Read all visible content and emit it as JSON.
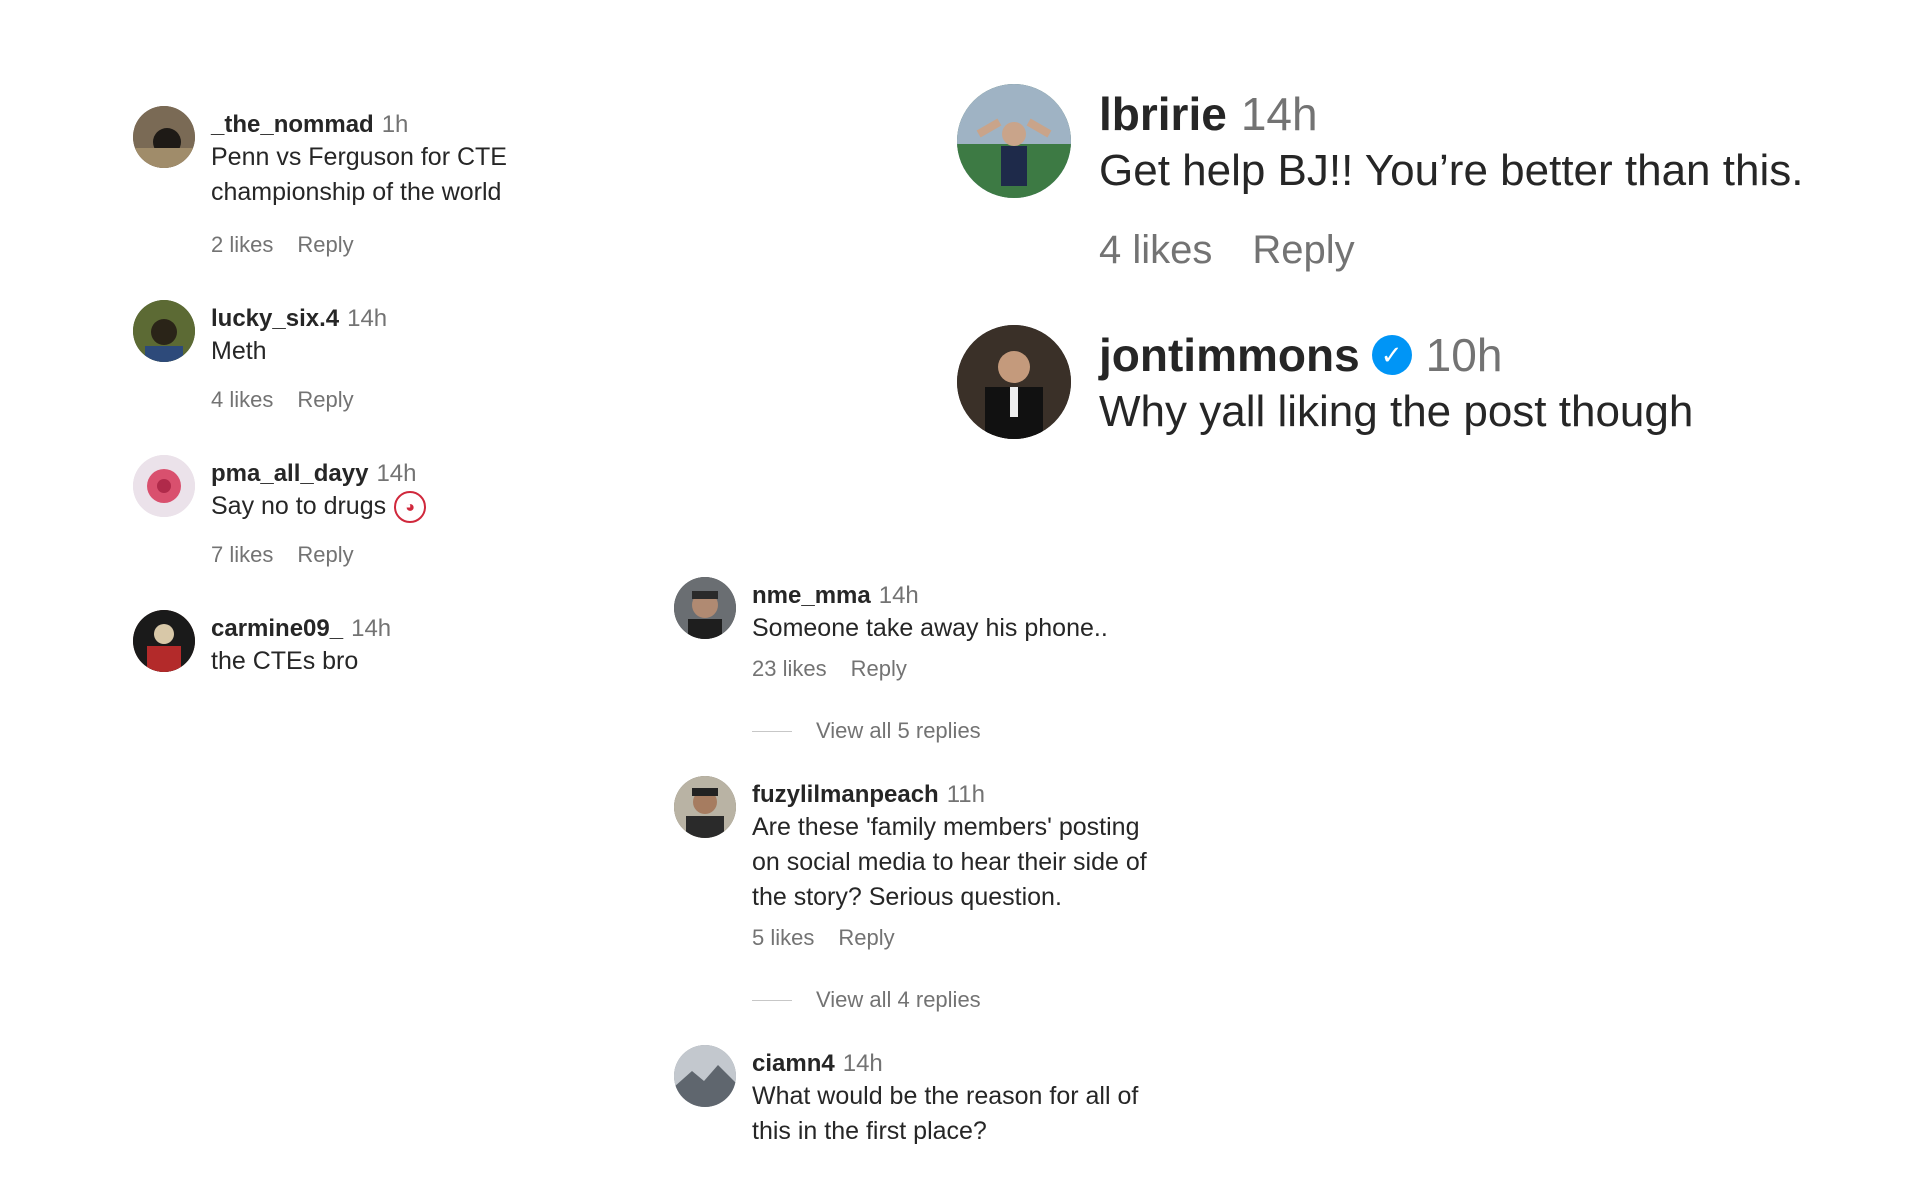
{
  "left_comments": [
    {
      "username": "_the_nommad",
      "time": "1h",
      "text_lines": [
        "Penn vs Ferguson for CTE",
        "championship of the world"
      ],
      "likes": "2 likes",
      "reply": "Reply",
      "avatar_color": "#6b5a44"
    },
    {
      "username": "lucky_six.4",
      "time": "14h",
      "text_lines": [
        "Meth"
      ],
      "likes": "4 likes",
      "reply": "Reply",
      "avatar_color": "#4a5a2e"
    },
    {
      "username": "pma_all_dayy",
      "time": "14h",
      "text_lines": [
        "Say no to drugs"
      ],
      "emoji": "clown-face",
      "likes": "7 likes",
      "reply": "Reply",
      "avatar_color": "#d9506e"
    },
    {
      "username": "carmine09_",
      "time": "14h",
      "text_lines": [
        "the CTEs bro"
      ],
      "avatar_color": "#5a2a22"
    }
  ],
  "right_comments": [
    {
      "username": "lbririe",
      "time": "14h",
      "text": "Get help BJ!! You’re better than this.",
      "likes": "4 likes",
      "reply": "Reply",
      "avatar_color": "#3b6b4a"
    },
    {
      "username": "jontimmons",
      "verified": true,
      "time": "10h",
      "text": "Why yall liking the post though",
      "avatar_color": "#2d2a26"
    }
  ],
  "middle_comments": [
    {
      "username": "nme_mma",
      "time": "14h",
      "text_lines": [
        "Someone take away his phone.."
      ],
      "likes": "23 likes",
      "reply": "Reply",
      "view_replies": "View all 5 replies",
      "avatar_color": "#3f3f3f"
    },
    {
      "username": "fuzylilmanpeach",
      "time": "11h",
      "text_lines": [
        "Are these 'family members' posting",
        "on social media to hear their side of",
        "the story? Serious question."
      ],
      "likes": "5 likes",
      "reply": "Reply",
      "view_replies": "View all 4 replies",
      "avatar_color": "#6b6250"
    },
    {
      "username": "ciamn4",
      "time": "14h",
      "text_lines": [
        "What would be the reason for all of",
        "this in the first place?"
      ],
      "avatar_color": "#8a8f96"
    }
  ],
  "colors": {
    "username": "#262626",
    "secondary": "#737373",
    "verified": "#0095f6",
    "divider": "#c7c7c7"
  }
}
